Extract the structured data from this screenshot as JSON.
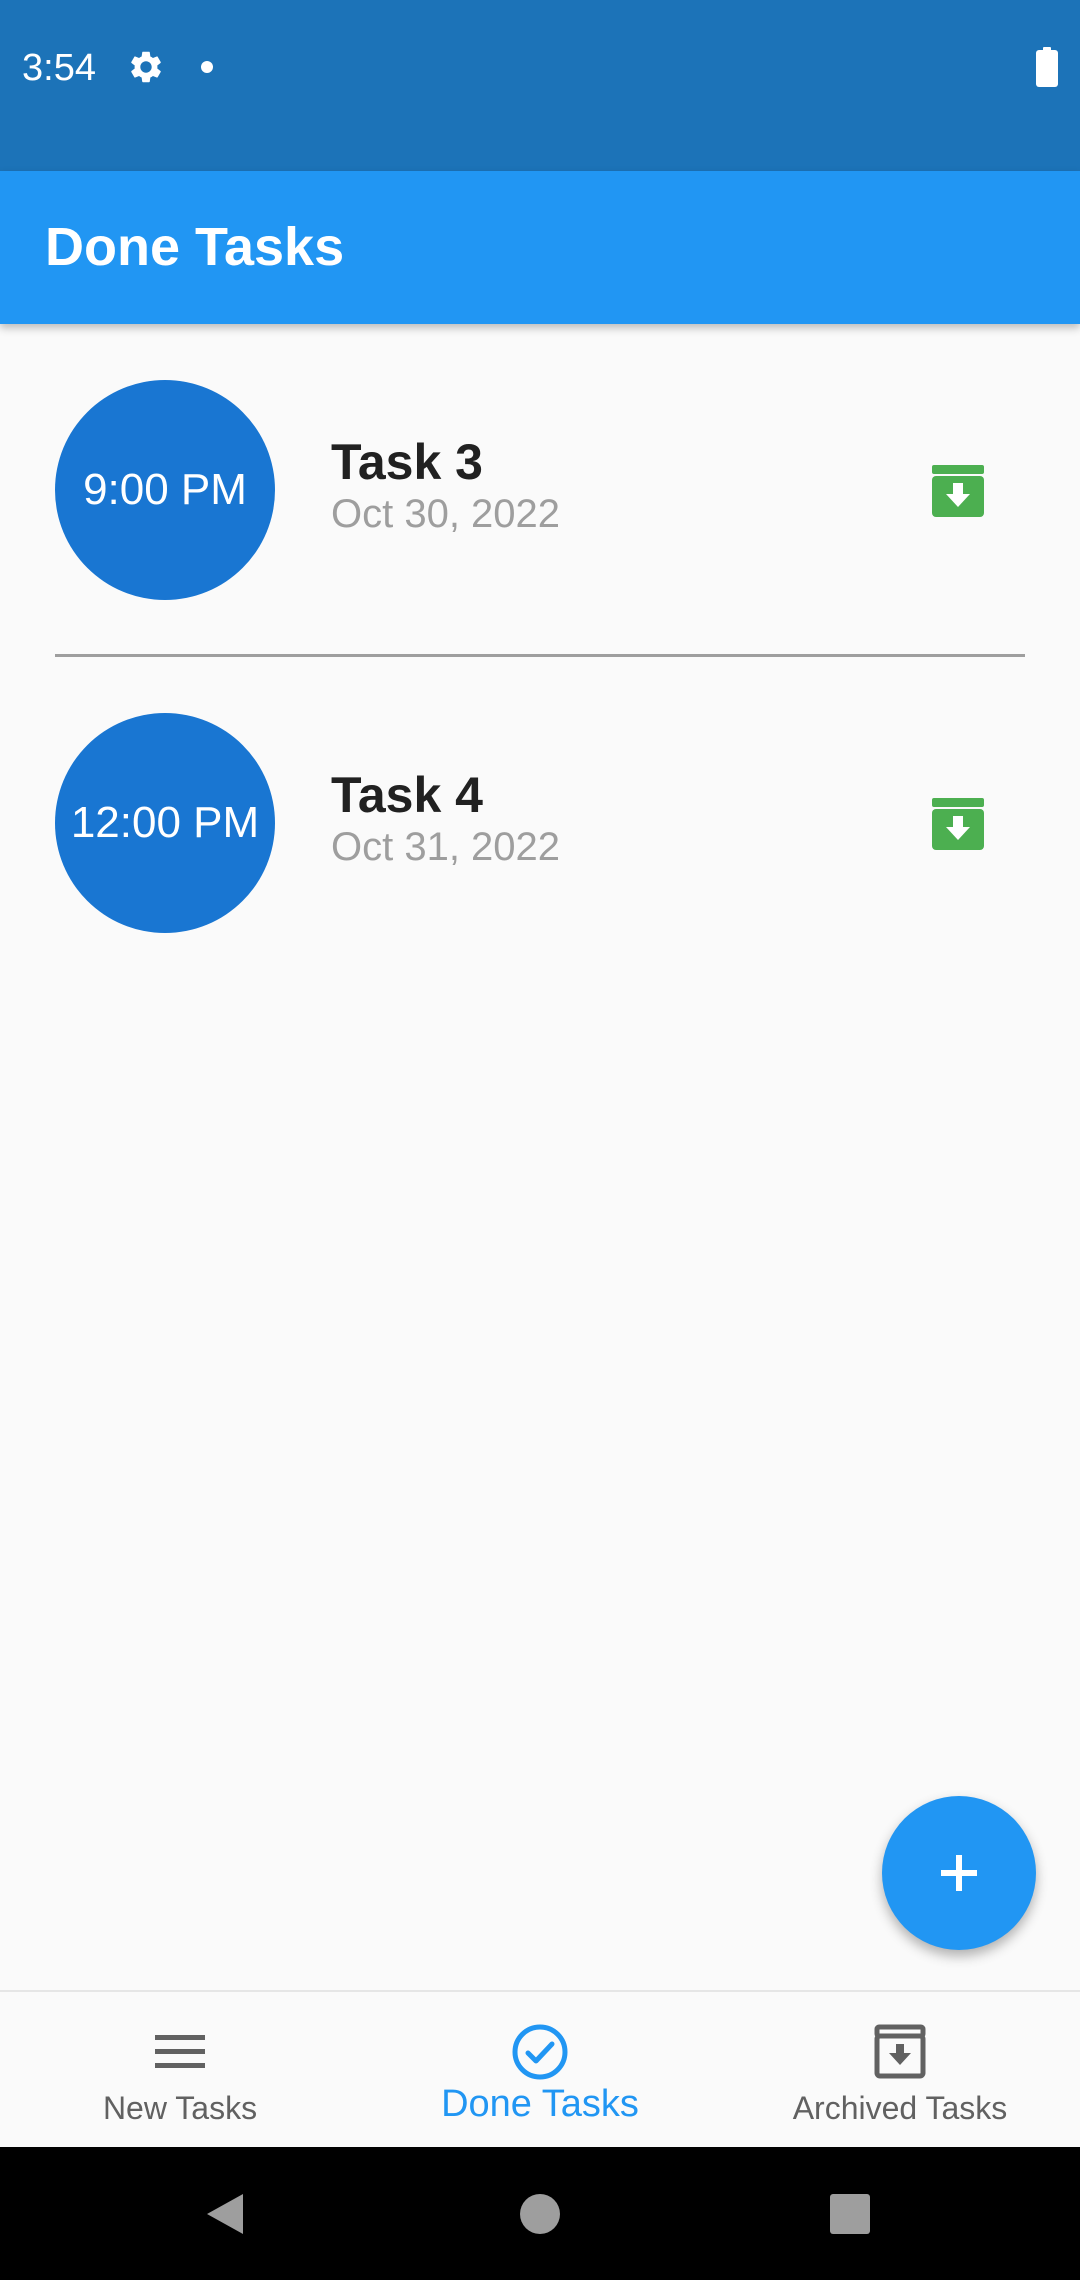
{
  "status_bar": {
    "time": "3:54",
    "icons": [
      "gear-icon",
      "notification-dot",
      "battery-icon"
    ],
    "background": "#1c73b8"
  },
  "app_bar": {
    "title": "Done Tasks",
    "background": "#2196f3"
  },
  "tasks": [
    {
      "time": "9:00 PM",
      "title": "Task 3",
      "date": "Oct 30, 2022",
      "action_icon": "archive-icon"
    },
    {
      "time": "12:00 PM",
      "title": "Task 4",
      "date": "Oct 31, 2022",
      "action_icon": "archive-icon"
    }
  ],
  "fab": {
    "icon": "plus-icon"
  },
  "bottom_nav": {
    "items": [
      {
        "label": "New Tasks",
        "icon": "menu-icon",
        "active": false
      },
      {
        "label": "Done Tasks",
        "icon": "check-circle-icon",
        "active": true
      },
      {
        "label": "Archived Tasks",
        "icon": "archive-icon",
        "active": false
      }
    ]
  },
  "system_nav": {
    "buttons": [
      "back-icon",
      "home-icon",
      "recents-icon"
    ]
  },
  "colors": {
    "primary": "#2196f3",
    "time_circle": "#1976d2",
    "archive_green": "#4caf50",
    "inactive": "#616161"
  }
}
